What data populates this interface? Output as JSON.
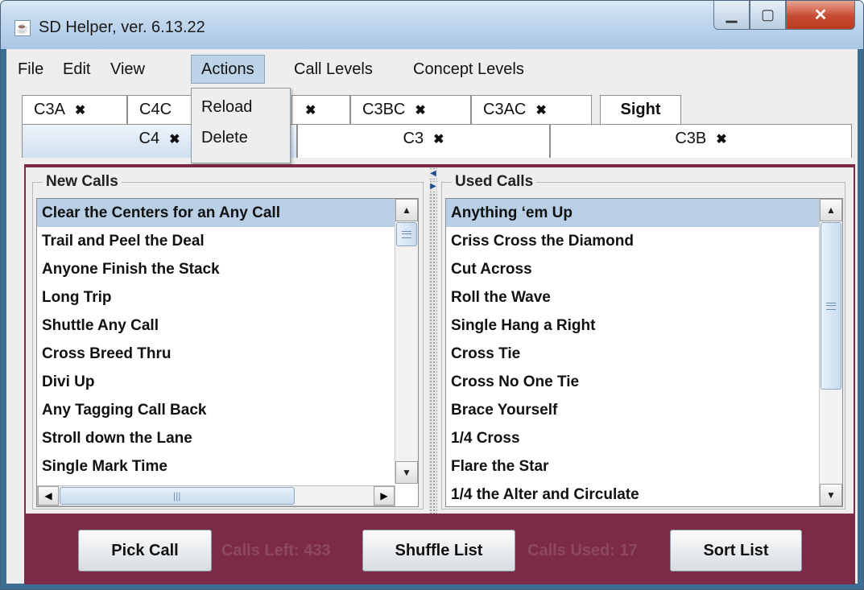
{
  "window": {
    "title": "SD Helper, ver. 6.13.22"
  },
  "menu": {
    "file": "File",
    "edit": "Edit",
    "view": "View",
    "actions": "Actions",
    "call_levels": "Call Levels",
    "concept_levels": "Concept Levels"
  },
  "actions_menu": {
    "reload": "Reload",
    "delete": "Delete"
  },
  "tabs": {
    "row1": [
      "C3A",
      "C4C",
      "C3BC",
      "C3AC",
      "Sight"
    ],
    "row2": [
      "C4",
      "C3",
      "C3B"
    ]
  },
  "new_calls": {
    "title": "New Calls",
    "items": [
      "Clear the Centers for an Any Call",
      "Trail and Peel the Deal",
      "Anyone Finish the Stack",
      "Long Trip",
      "Shuttle Any Call",
      "Cross Breed Thru",
      "Divi Up",
      "Any Tagging Call Back",
      "Stroll down the Lane",
      "Single Mark Time"
    ]
  },
  "used_calls": {
    "title": "Used Calls",
    "items": [
      "Anything ‘em Up",
      "Criss Cross the Diamond",
      "Cut Across",
      "Roll the Wave",
      "Single Hang a Right",
      "Cross Tie",
      "Cross No One Tie",
      "Brace Yourself",
      "1/4 Cross",
      "Flare the Star",
      "1/4 the Alter and Circulate"
    ]
  },
  "footer": {
    "pick": "Pick Call",
    "calls_left": "Calls Left: 433",
    "shuffle": "Shuffle List",
    "calls_used": "Calls Used: 17",
    "sort": "Sort List"
  },
  "colors": {
    "content_bg": "#7b2b45",
    "status_text": "#8c4960",
    "selection": "#b8cfe5"
  },
  "icons": {
    "app": "java-cup-icon",
    "minimize": "minimize-icon",
    "maximize": "maximize-icon",
    "close": "close-icon",
    "tab_close": "close-x-icon"
  }
}
